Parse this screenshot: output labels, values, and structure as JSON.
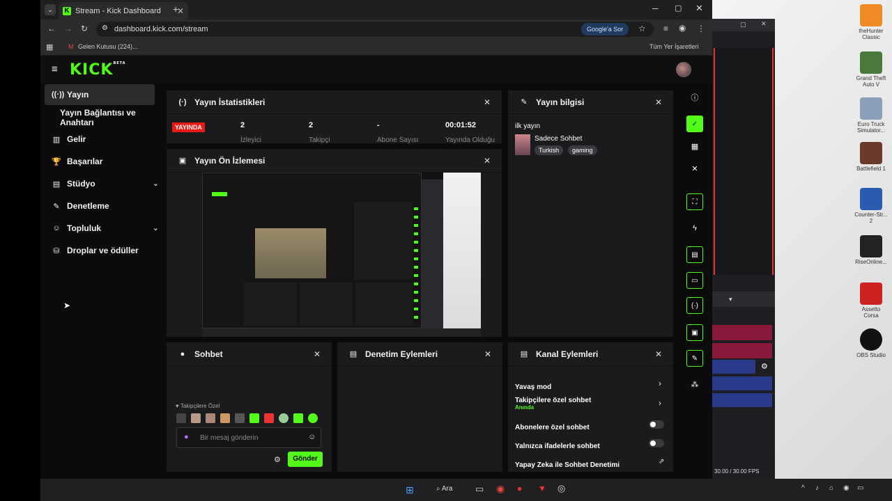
{
  "browser": {
    "tab_title": "Stream - Kick Dashboard",
    "url": "dashboard.kick.com/stream",
    "ask_google_label": "Google'a Sor",
    "bookmark_inbox": "Gelen Kutusu (224)...",
    "all_bookmarks": "Tüm Yer İşaretleri"
  },
  "kick": {
    "logo": "KICK",
    "logo_badge": "BETA"
  },
  "sidebar": {
    "items": [
      {
        "label": "Yayın",
        "icon": "broadcast-icon"
      },
      {
        "label": "Yayın Bağlantısı ve Anahtarı",
        "icon": ""
      },
      {
        "label": "Gelir",
        "icon": "chart-icon"
      },
      {
        "label": "Başarılar",
        "icon": "trophy-icon"
      },
      {
        "label": "Stüdyo",
        "icon": "studio-icon"
      },
      {
        "label": "Denetleme",
        "icon": "wrench-icon"
      },
      {
        "label": "Topluluk",
        "icon": "community-icon"
      },
      {
        "label": "Droplar ve ödüller",
        "icon": "drops-icon"
      }
    ]
  },
  "stats": {
    "title": "Yayın İstatistikleri",
    "live_badge": "YAYINDA",
    "viewers_value": "2",
    "viewers_label": "İzleyici",
    "followers_value": "2",
    "followers_label": "Takipçi",
    "subs_value": "-",
    "subs_label": "Abone Sayısı",
    "uptime_value": "00:01:52",
    "uptime_label": "Yayında Olduğu"
  },
  "preview": {
    "title": "Yayın Ön İzlemesi"
  },
  "info": {
    "title": "Yayın bilgisi",
    "stream_title": "ilk yayın",
    "category": "Sadece Sohbet",
    "tags": [
      "Turkish",
      "gaming"
    ]
  },
  "chat": {
    "title": "Sohbet",
    "followers_only": "Takipçilere Özel",
    "placeholder": "Bir mesaj gönderin",
    "send": "Gönder"
  },
  "moderation": {
    "title": "Denetim Eylemleri"
  },
  "channel": {
    "title": "Kanal Eylemleri",
    "slow_mode": "Yavaş mod",
    "followers_chat": "Takipçilere özel sohbet",
    "followers_chat_sub": "Anında",
    "subs_chat": "Abonelere özel sohbet",
    "emotes_chat": "Yalnızca ifadelerle sohbet",
    "ai_moderation": "Yapay Zeka ile Sohbet Denetimi"
  },
  "desktop": {
    "icons": [
      "theHunter Classic",
      "Grand Theft Auto V",
      "Euro Truck Simulator...",
      "Battlefield 1",
      "Counter-Str... 2",
      "RiseOnline...",
      "Assetto Corsa",
      "OBS Studio"
    ],
    "obs_fps": "30.00 / 30.00 FPS"
  },
  "taskbar": {
    "search": "Ara"
  },
  "colors": {
    "accent": "#53fc18",
    "live": "#e91916",
    "panel": "#1a1b1d"
  }
}
